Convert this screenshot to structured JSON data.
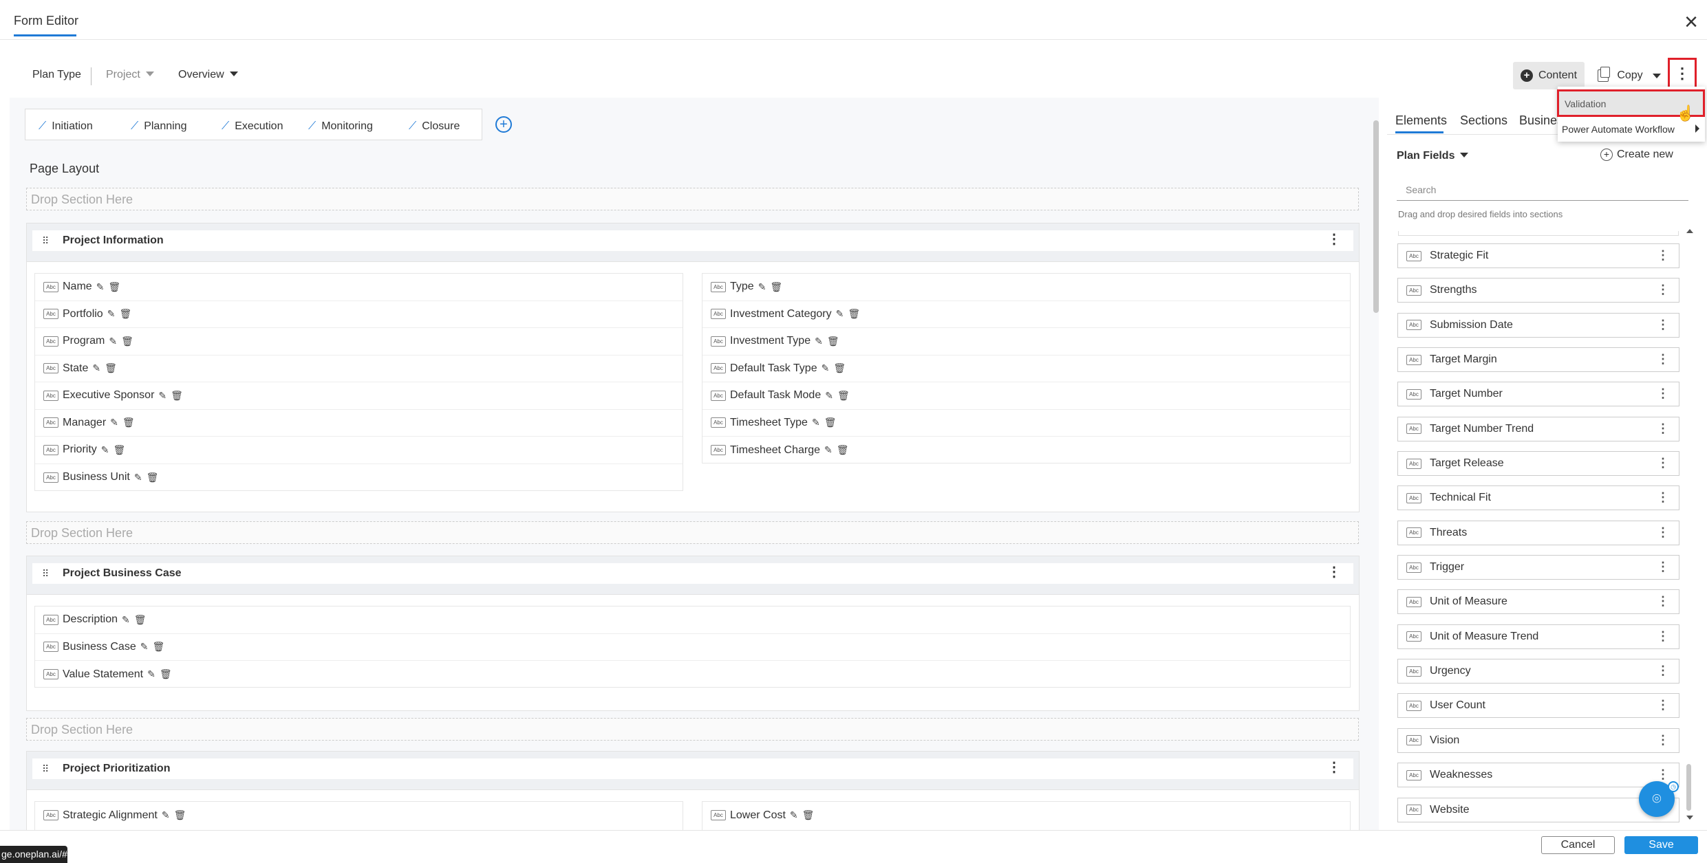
{
  "window": {
    "title": "Form Editor",
    "close_icon": "close-icon"
  },
  "toolbar": {
    "plan_type": "Plan Type",
    "project": "Project",
    "overview": "Overview",
    "content": "Content",
    "copy": "Copy",
    "more_icon": "vertical-dots-icon"
  },
  "menu": {
    "items": [
      {
        "label": "Validation"
      },
      {
        "label": "Power Automate Workflow"
      }
    ]
  },
  "phases": [
    "Initiation",
    "Planning",
    "Execution",
    "Monitoring",
    "Closure"
  ],
  "page_layout_label": "Page Layout",
  "drop_section_label": "Drop Section Here",
  "sections": [
    {
      "title": "Project Information",
      "left_fields": [
        "Name",
        "Portfolio",
        "Program",
        "State",
        "Executive Sponsor",
        "Manager",
        "Priority",
        "Business Unit"
      ],
      "right_fields": [
        "Type",
        "Investment Category",
        "Investment Type",
        "Default Task Type",
        "Default Task Mode",
        "Timesheet Type",
        "Timesheet Charge"
      ]
    },
    {
      "title": "Project Business Case",
      "fields": [
        "Description",
        "Business Case",
        "Value Statement"
      ]
    },
    {
      "title": "Project Prioritization",
      "left_fields": [
        "Strategic Alignment"
      ],
      "right_fields": [
        "Lower Cost"
      ]
    }
  ],
  "right_panel": {
    "tabs": [
      "Elements",
      "Sections",
      "Busines"
    ],
    "plan_fields": "Plan Fields",
    "create_new": "Create new",
    "search_placeholder": "Search",
    "hint": "Drag and drop desired fields into sections",
    "elements": [
      "Strategic Fit",
      "Strengths",
      "Submission Date",
      "Target Margin",
      "Target Number",
      "Target Number Trend",
      "Target Release",
      "Technical Fit",
      "Threats",
      "Trigger",
      "Unit of Measure",
      "Unit of Measure Trend",
      "Urgency",
      "User Count",
      "Vision",
      "Weaknesses",
      "Website"
    ]
  },
  "footer": {
    "cancel": "Cancel",
    "save": "Save"
  },
  "status_url": "ge.oneplan.ai/#",
  "field_type_badge": "Abc",
  "colors": {
    "accent": "#1f7ad6",
    "save_button": "#1f8fe0",
    "highlight_border": "#e0202a"
  }
}
